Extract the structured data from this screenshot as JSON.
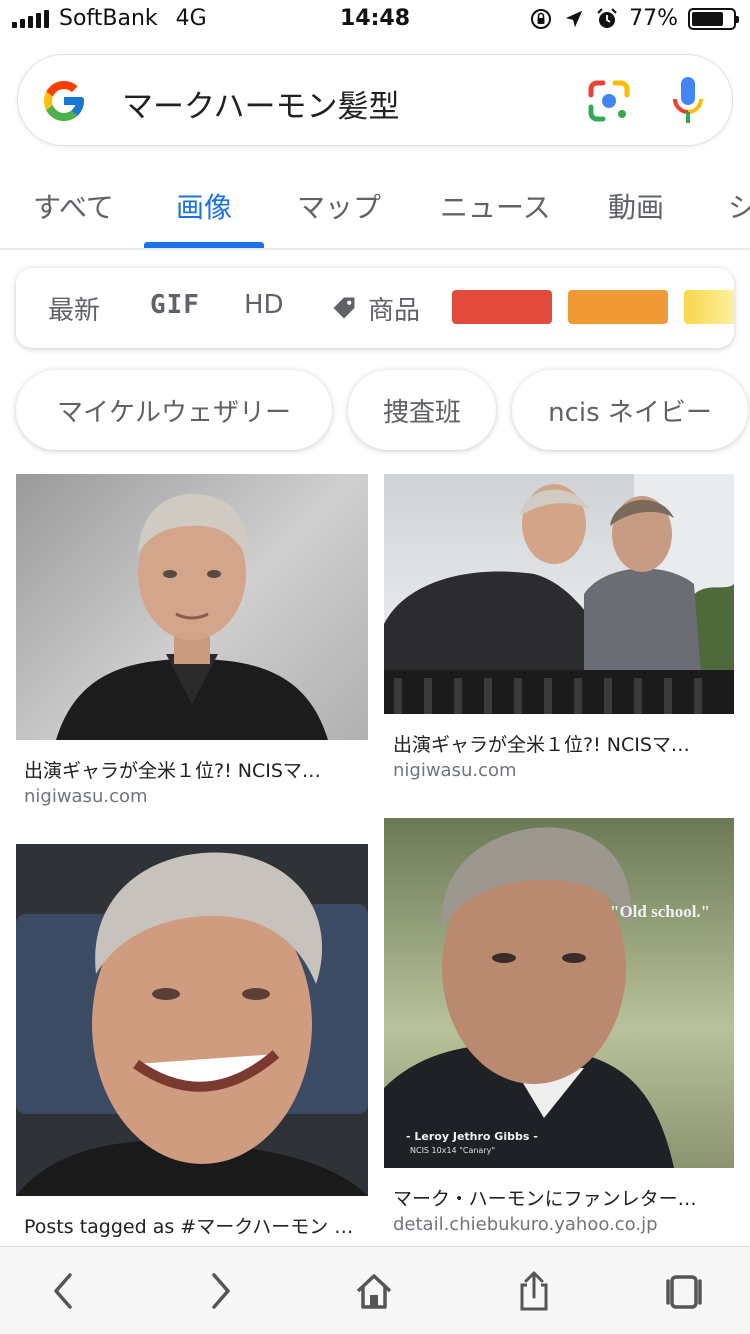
{
  "status_bar": {
    "carrier": "SoftBank",
    "network": "4G",
    "time": "14:48",
    "battery": "77%",
    "battery_level": 0.77
  },
  "search": {
    "query": "マークハーモン髪型"
  },
  "tabs": [
    {
      "label": "すべて"
    },
    {
      "label": "画像"
    },
    {
      "label": "マップ"
    },
    {
      "label": "ニュース"
    },
    {
      "label": "動画"
    },
    {
      "label": "シ"
    }
  ],
  "filters": {
    "latest": "最新",
    "gif": "GIF",
    "hd": "HD",
    "products": "商品",
    "colors": [
      "#e34b3c",
      "#f09a35",
      "#f6d84a"
    ]
  },
  "chips": [
    {
      "label": "マイケルウェザリー"
    },
    {
      "label": "捜査班"
    },
    {
      "label": "ncis ネイビー"
    }
  ],
  "results": [
    {
      "caption": "出演ギャラが全米１位?! NCISマ…",
      "source": "nigiwasu.com"
    },
    {
      "caption": "出演ギャラが全米１位?! NCISマ…",
      "source": "nigiwasu.com"
    },
    {
      "caption": "Posts tagged as #マークハーモン …",
      "source": ""
    },
    {
      "caption": "マーク・ハーモンにファンレター…",
      "source": "detail.chiebukuro.yahoo.co.jp",
      "overlay_quote": "\"Old school.\"",
      "overlay_name": "- Leroy Jethro Gibbs -",
      "overlay_episode": "NCIS 10x14 \"Canary\""
    }
  ]
}
